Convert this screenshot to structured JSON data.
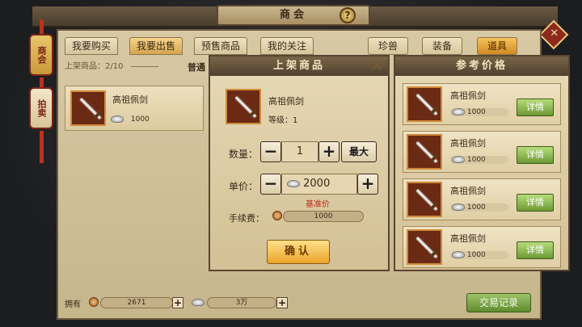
{
  "header": {
    "title": "商会"
  },
  "side_tabs": [
    "商会",
    "拍卖"
  ],
  "tabs": [
    "我要购买",
    "我要出售",
    "预售商品",
    "我的关注"
  ],
  "categories": [
    "珍兽",
    "装备",
    "道具"
  ],
  "listed": {
    "label": "上架商品：",
    "count": "2/10"
  },
  "filter_label": "普通",
  "owned_item": {
    "name": "高祖佩剑",
    "price": "1000"
  },
  "footer": {
    "own_label": "拥有",
    "copper": "2671",
    "silver": "3万",
    "record_button": "交易记录"
  },
  "list_dialog": {
    "title": "上架商品",
    "item_name": "高祖佩剑",
    "level_label": "等级：1",
    "qty_label": "数量：",
    "qty_value": "1",
    "max_label": "最大",
    "price_label": "单价：",
    "price_value": "2000",
    "base_price_label": "基准价",
    "fee_label": "手续费：",
    "fee_value": "1000",
    "confirm_label": "确认"
  },
  "ref_dialog": {
    "title": "参考价格",
    "items": [
      {
        "name": "高祖佩剑",
        "price": "1000",
        "button": "详情"
      },
      {
        "name": "高祖佩剑",
        "price": "1000",
        "button": "详情"
      },
      {
        "name": "高祖佩剑",
        "price": "1000",
        "button": "详情"
      },
      {
        "name": "高祖佩剑",
        "price": "1000",
        "button": "详情"
      }
    ]
  },
  "colors": {
    "accent_gold": "#eaa32a",
    "detail_green": "#6c9a34",
    "lantern_red": "#7a2418"
  }
}
